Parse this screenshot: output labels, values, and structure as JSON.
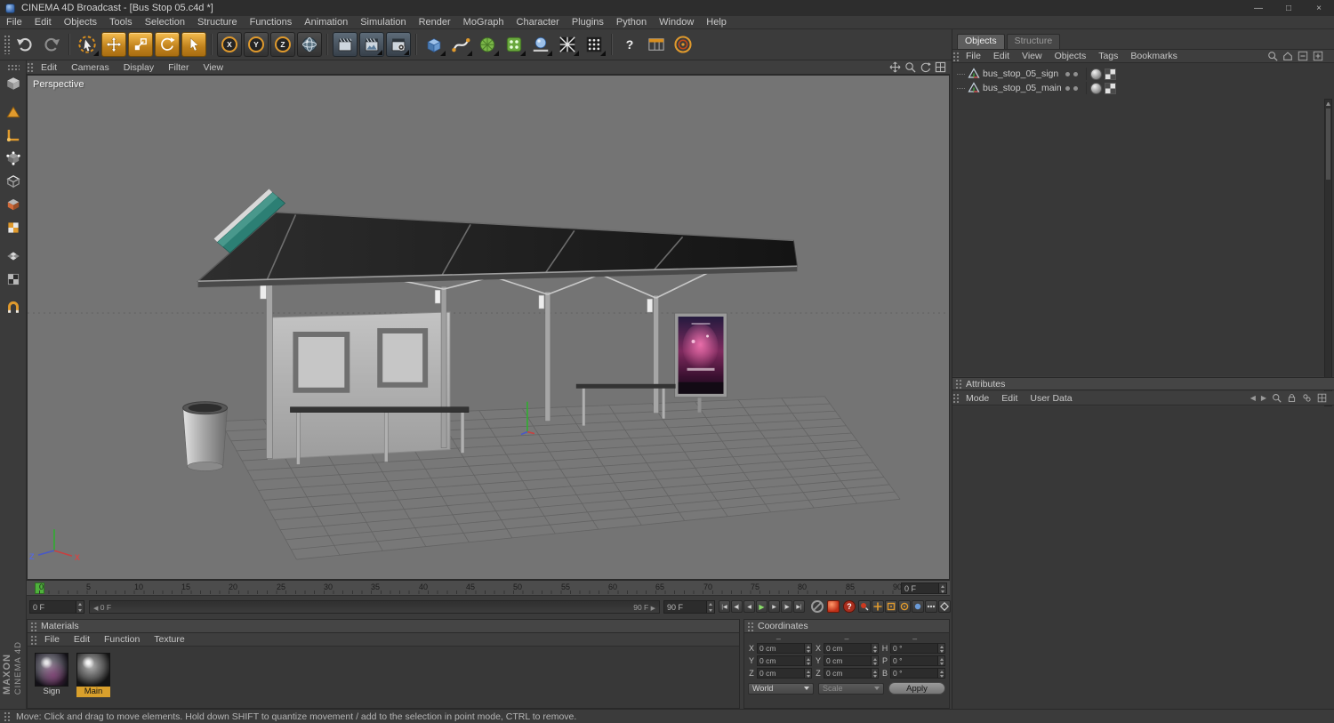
{
  "window": {
    "title": "CINEMA 4D Broadcast - [Bus Stop 05.c4d *]",
    "minimize": "—",
    "maximize": "□",
    "close": "×"
  },
  "menubar": [
    "File",
    "Edit",
    "Objects",
    "Tools",
    "Selection",
    "Structure",
    "Functions",
    "Animation",
    "Simulation",
    "Render",
    "MoGraph",
    "Character",
    "Plugins",
    "Python",
    "Window",
    "Help"
  ],
  "toolbar": {
    "axis_locks": [
      "X",
      "Y",
      "Z"
    ],
    "help_glyph": "?"
  },
  "viewport": {
    "label": "Perspective",
    "menu": [
      "Edit",
      "Cameras",
      "Display",
      "Filter",
      "View"
    ],
    "axis_labels": {
      "x": "X",
      "z": "Z"
    }
  },
  "object_manager": {
    "tab_objects": "Objects",
    "tab_structure": "Structure",
    "menu": [
      "File",
      "Edit",
      "View",
      "Objects",
      "Tags",
      "Bookmarks"
    ],
    "objects": [
      {
        "name": "bus_stop_05_sign"
      },
      {
        "name": "bus_stop_05_main"
      }
    ]
  },
  "attributes": {
    "title": "Attributes",
    "menu": [
      "Mode",
      "Edit",
      "User Data"
    ],
    "nav_back": "◀",
    "nav_forward": "▶"
  },
  "timeline": {
    "ticks": [
      "0",
      "5",
      "10",
      "15",
      "20",
      "25",
      "30",
      "35",
      "40",
      "45",
      "50",
      "55",
      "60",
      "65",
      "70",
      "75",
      "80",
      "85",
      "90"
    ],
    "current_frame": "0 F",
    "range_start": "0 F",
    "marker_start_glyph": "◀",
    "marker_start": "0 F",
    "marker_end": "90 F",
    "marker_end_glyph": "▶",
    "range_end": "90 F",
    "autokey_glyph": "?",
    "transport": {
      "goto_start": "|◀",
      "prev_key": "◀|",
      "prev_frame": "◀",
      "play": "▶",
      "next_frame": "▶",
      "next_key": "|▶",
      "goto_end": "▶|"
    }
  },
  "materials": {
    "title": "Materials",
    "menu": [
      "File",
      "Edit",
      "Function",
      "Texture"
    ],
    "items": [
      {
        "label": "Sign",
        "selected": false
      },
      {
        "label": "Main",
        "selected": true
      }
    ]
  },
  "coordinates": {
    "title": "Coordinates",
    "headers": [
      "–",
      "–",
      "–"
    ],
    "position": {
      "labels": [
        "X",
        "Y",
        "Z"
      ],
      "values": [
        "0 cm",
        "0 cm",
        "0 cm"
      ]
    },
    "size": {
      "labels": [
        "X",
        "Y",
        "Z"
      ],
      "values": [
        "0 cm",
        "0 cm",
        "0 cm"
      ]
    },
    "rotation": {
      "labels": [
        "H",
        "P",
        "B"
      ],
      "values": [
        "0 °",
        "0 °",
        "0 °"
      ]
    },
    "space": "World",
    "mode": "Scale",
    "apply": "Apply"
  },
  "statusbar": {
    "text": "Move: Click and drag to move elements. Hold down SHIFT to quantize movement / add to the selection in point mode, CTRL to remove."
  },
  "branding": {
    "maxon": "MAXON",
    "cinema": "CINEMA 4D"
  },
  "colors": {
    "accent_orange": "#e09a2d",
    "viewport_bg": "#747474",
    "marker_green": "#4fb13c",
    "sign_teal": "#2c7f74",
    "poster_magenta": "#c24a86",
    "selected_material_label": "#d9a02c"
  }
}
